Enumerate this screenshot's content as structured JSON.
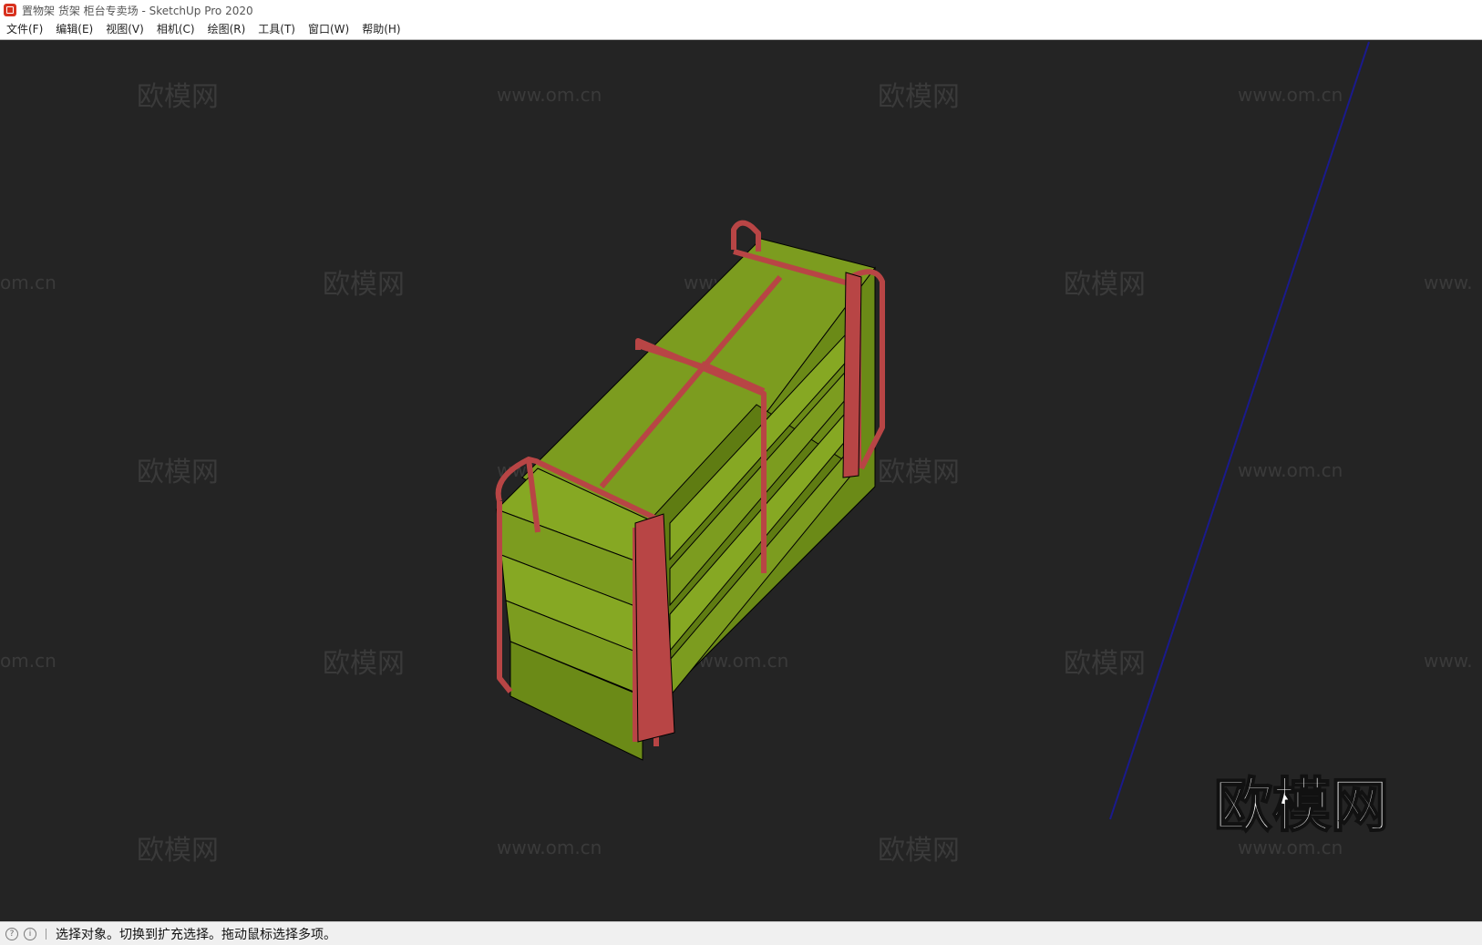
{
  "window": {
    "title": "置物架 货架 柜台专卖场 - SketchUp Pro 2020"
  },
  "menu": {
    "items": [
      {
        "label": "文件(F)"
      },
      {
        "label": "编辑(E)"
      },
      {
        "label": "视图(V)"
      },
      {
        "label": "相机(C)"
      },
      {
        "label": "绘图(R)"
      },
      {
        "label": "工具(T)"
      },
      {
        "label": "窗口(W)"
      },
      {
        "label": "帮助(H)"
      }
    ]
  },
  "viewport": {
    "background": "#242424",
    "watermark_brand": "欧模网",
    "watermark_url": "www.om.cn",
    "watermark_url_partial": "om.cn",
    "watermark_url_cut": "www.",
    "logo_text": "欧模网",
    "colors": {
      "shelf_green": "#7c9c1f",
      "frame_red": "#b84545",
      "axis_blue": "#1a1a8c"
    }
  },
  "status": {
    "icons": [
      "geo-location-icon",
      "info-icon"
    ],
    "text": "选择对象。切换到扩充选择。拖动鼠标选择多项。"
  }
}
